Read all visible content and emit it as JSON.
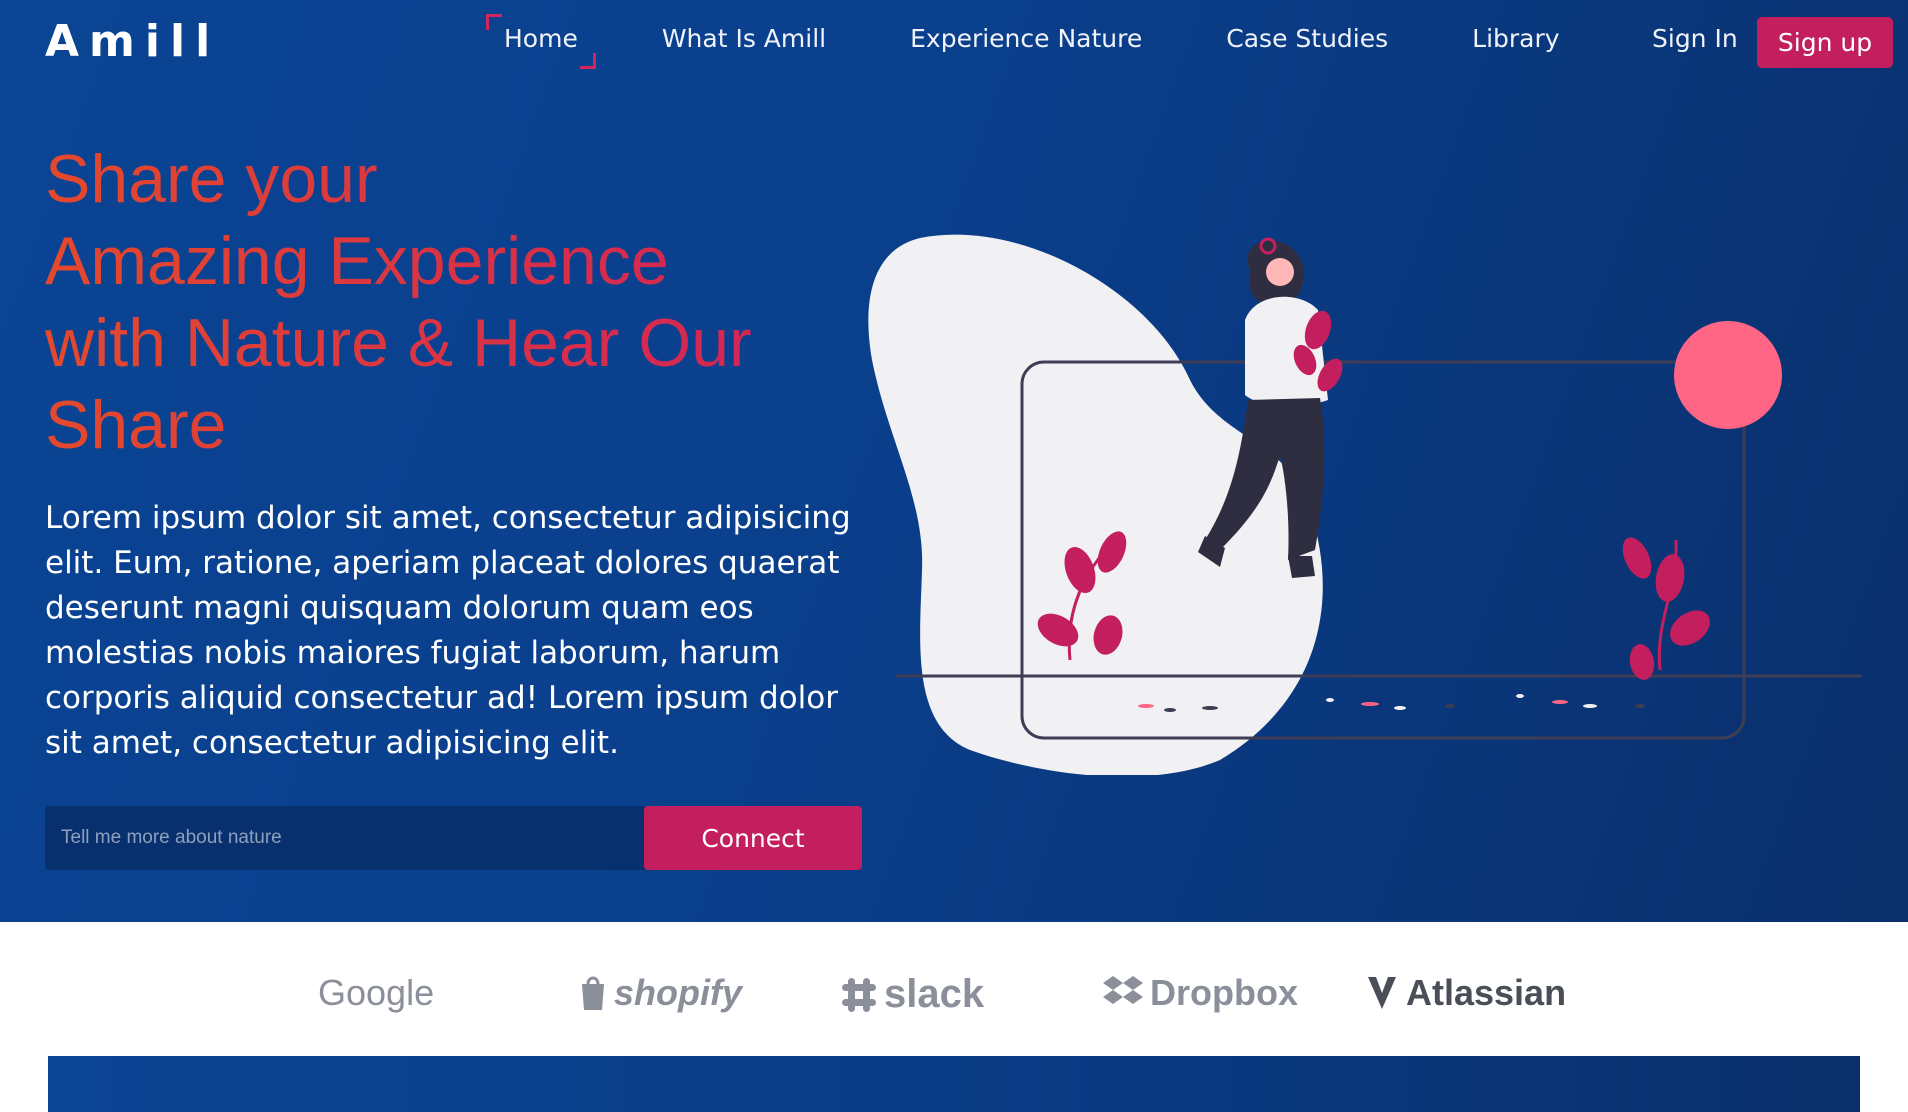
{
  "brand": {
    "name": "Amill"
  },
  "nav": {
    "items": [
      {
        "label": "Home",
        "active": true
      },
      {
        "label": "What Is Amill"
      },
      {
        "label": "Experience Nature"
      },
      {
        "label": "Case Studies"
      },
      {
        "label": "Library"
      }
    ],
    "sign_in": "Sign In",
    "sign_up": "Sign up"
  },
  "hero": {
    "headline_lines": [
      "Share your",
      "Amazing Experience",
      "with Nature & Hear Our",
      "Share"
    ],
    "paragraph": "Lorem ipsum dolor sit amet, consectetur adipisicing elit. Eum, ratione, aperiam placeat dolores quaerat deserunt magni quisquam dolorum quam eos molestias nobis maiores fugiat laborum, harum corporis aliquid consectetur ad! Lorem ipsum dolor sit amet, consectetur adipisicing elit.",
    "input_placeholder": "Tell me more about nature",
    "connect_label": "Connect"
  },
  "logos": [
    "Google",
    "shopify",
    "slack",
    "Dropbox",
    "Atlassian"
  ],
  "colors": {
    "accent": "#c31f5e",
    "hero_bg": "#0a3f8c",
    "headline_start": "#e4492c",
    "headline_end": "#d2235a",
    "sun": "#ff6584",
    "plant": "#c31f5e"
  }
}
